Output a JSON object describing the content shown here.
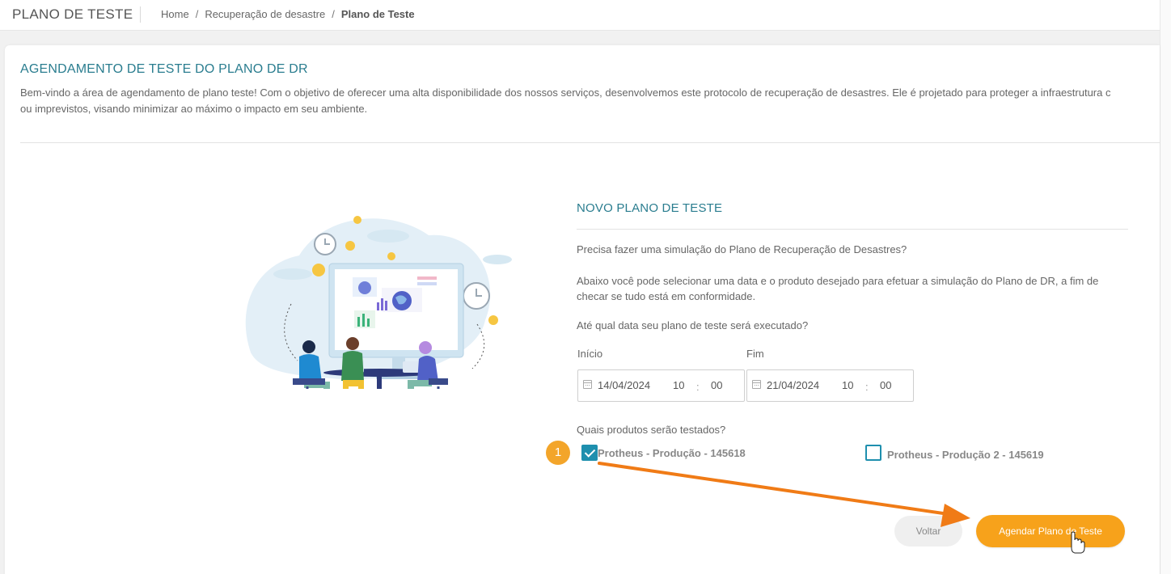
{
  "topbar": {
    "app_title": "PLANO DE TESTE",
    "breadcrumb": [
      "Home",
      "Recuperação de desastre",
      "Plano de Teste"
    ],
    "separator": "/"
  },
  "page": {
    "title": "AGENDAMENTO DE TESTE DO PLANO DE DR",
    "intro_line1": "Bem-vindo a área de agendamento de plano teste! Com o objetivo de oferecer uma alta disponibilidade dos nossos serviços, desenvolvemos este protocolo de recuperação de desastres. Ele é projetado para proteger a infraestrutura c",
    "intro_line2": "ou imprevistos, visando minimizar ao máximo o impacto em seu ambiente."
  },
  "form": {
    "title": "NOVO PLANO DE TESTE",
    "question_simulation": "Precisa fazer uma simulação do Plano de Recuperação de Desastres?",
    "explanation": "Abaixo você pode selecionar uma data e o produto desejado para efetuar a simulação do Plano de DR, a fim de checar se tudo está em conformidade.",
    "question_date": "Até qual data seu plano de teste será executado?",
    "start": {
      "label": "Início",
      "date": "14/04/2024",
      "hour": "10",
      "minute": "00"
    },
    "end": {
      "label": "Fim",
      "date": "21/04/2024",
      "hour": "10",
      "minute": "00"
    },
    "time_separator": ":",
    "question_products": "Quais produtos serão testados?",
    "products": [
      {
        "label": "Protheus - Produção - 145618",
        "checked": true
      },
      {
        "label": "Protheus - Produção 2 - 145619",
        "checked": false
      }
    ],
    "back_label": "Voltar",
    "schedule_label": "Agendar Plano de Teste"
  },
  "annotation": {
    "step_number": "1",
    "color": "#f3a52a",
    "arrow_color": "#f07b16"
  },
  "colors": {
    "accent": "#2a7d8f",
    "checkbox": "#1e8fae",
    "primary_button": "#f7a21b"
  }
}
